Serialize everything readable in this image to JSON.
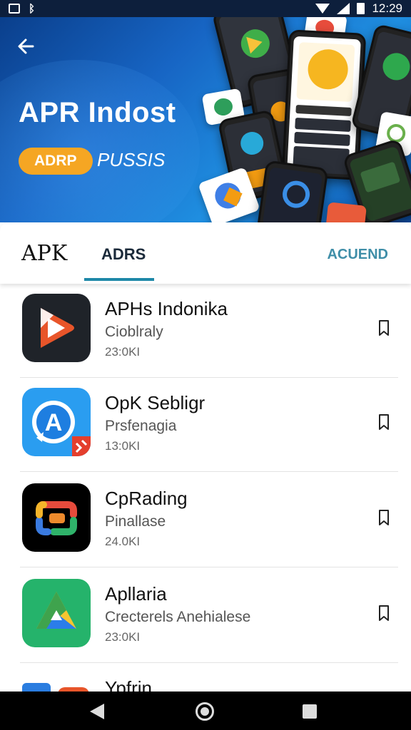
{
  "status_bar": {
    "time": "12:29"
  },
  "hero": {
    "title": "APR Indost",
    "pill_label": "ADRP",
    "subtitle": "PUSSIS"
  },
  "tabs": {
    "brand": "APK",
    "active": "ADRS",
    "right": "ACUEND"
  },
  "apps": [
    {
      "name": "APHs Indonika",
      "category": "Cioblraly",
      "size": "23:0KI",
      "icon": "play-icon"
    },
    {
      "name": "OpK Sebligr",
      "category": "Prsfenagia",
      "size": "13:0KI",
      "icon": "compass-a-icon"
    },
    {
      "name": "CpRading",
      "category": "Pinallase",
      "size": "24.0KI",
      "icon": "loop-icon"
    },
    {
      "name": "Apllaria",
      "category": "Crecterels Anehialese",
      "size": "23:0KI",
      "icon": "triangle-drive-icon"
    },
    {
      "name": "Ypfrin",
      "category": "",
      "size": "",
      "icon": "partial-app-icon"
    }
  ],
  "colors": {
    "accent": "#1e88a8",
    "pill": "#f5a623",
    "hero": "#1765c4"
  }
}
